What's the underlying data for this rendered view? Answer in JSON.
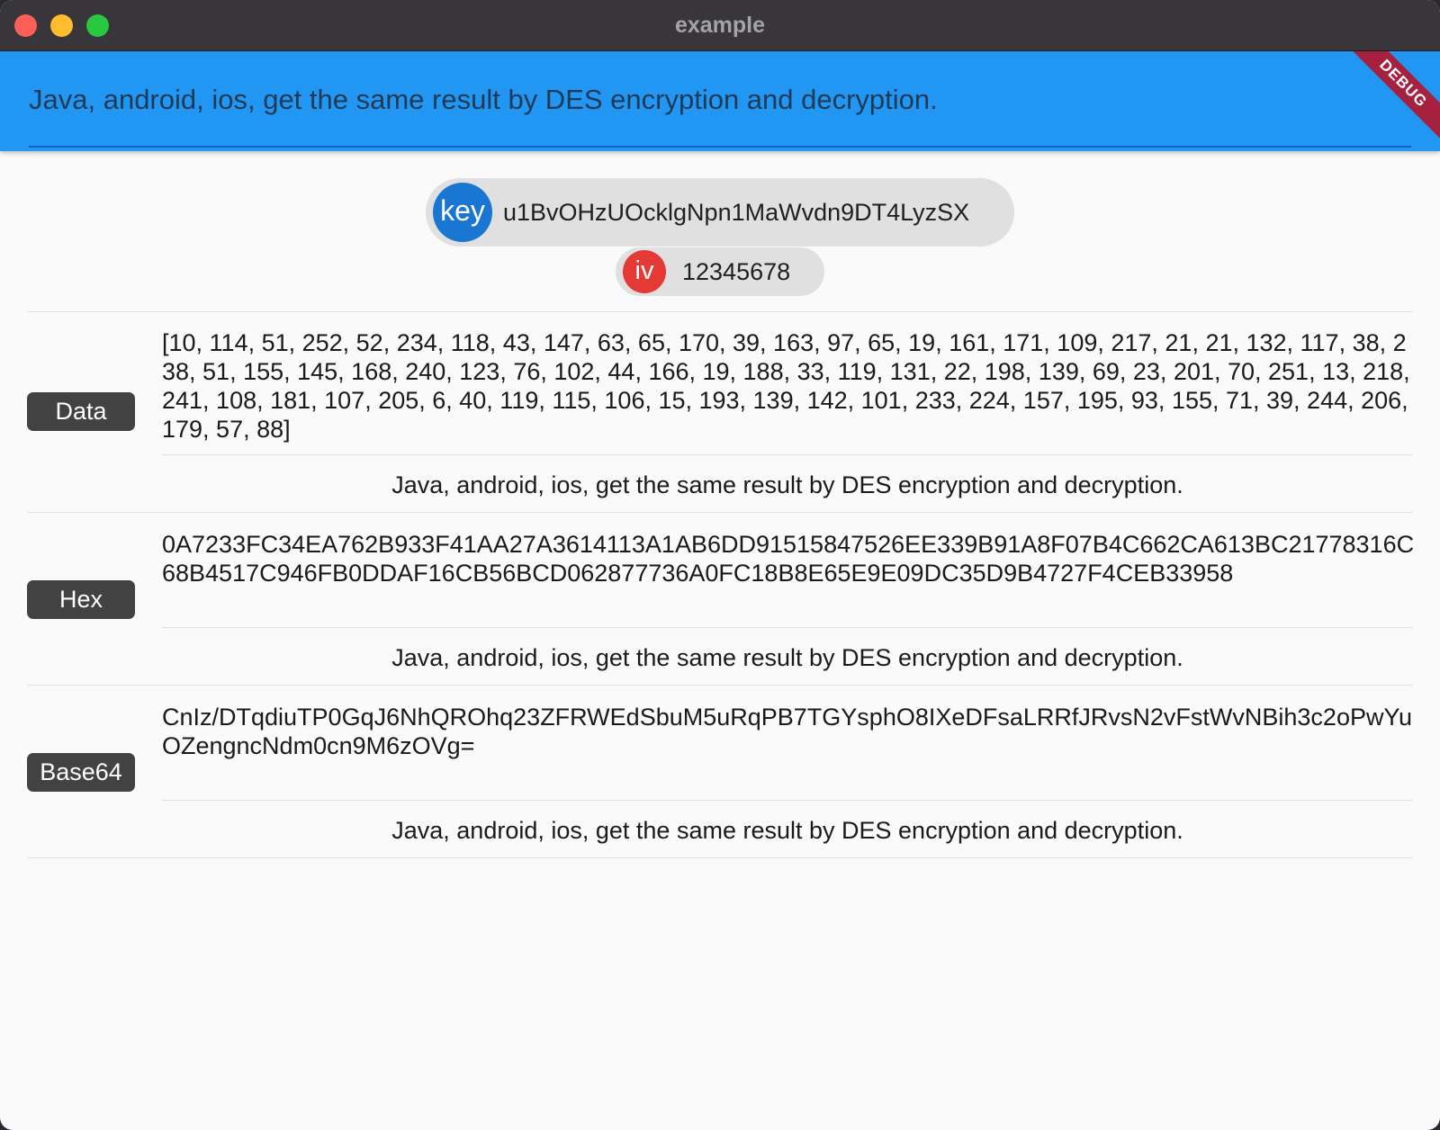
{
  "window": {
    "title": "example"
  },
  "appbar": {
    "input_value": "Java, android, ios, get the same result by DES encryption and decryption.",
    "debug_banner": "DEBUG"
  },
  "params": {
    "key": {
      "avatar": "key",
      "value": "u1BvOHzUOcklgNpn1MaWvdn9DT4LyzSX"
    },
    "iv": {
      "avatar": "iv",
      "value": "12345678"
    }
  },
  "sections": [
    {
      "label": "Data",
      "encoded": "[10, 114, 51, 252, 52, 234, 118, 43, 147, 63, 65, 170, 39, 163, 97, 65, 19, 161, 171, 109, 217, 21, 21, 132, 117, 38, 238, 51, 155, 145, 168, 240, 123, 76, 102, 44, 166, 19, 188, 33, 119, 131, 22, 198, 139, 69, 23, 201, 70, 251, 13, 218, 241, 108, 181, 107, 205, 6, 40, 119, 115, 106, 15, 193, 139, 142, 101, 233, 224, 157, 195, 93, 155, 71, 39, 244, 206, 179, 57, 88]",
      "decoded": "Java, android, ios, get the same result by DES encryption and decryption."
    },
    {
      "label": "Hex",
      "encoded": "0A7233FC34EA762B933F41AA27A3614113A1AB6DD91515847526EE339B91A8F07B4C662CA613BC21778316C68B4517C946FB0DDAF16CB56BCD062877736A0FC18B8E65E9E09DC35D9B4727F4CEB33958",
      "decoded": "Java, android, ios, get the same result by DES encryption and decryption."
    },
    {
      "label": "Base64",
      "encoded": "CnIz/DTqdiuTP0GqJ6NhQROhq23ZFRWEdSbuM5uRqPB7TGYsphO8IXeDFsaLRRfJRvsN2vFstWvNBih3c2oPwYuOZengncNdm0cn9M6zOVg=",
      "decoded": "Java, android, ios, get the same result by DES encryption and decryption."
    }
  ]
}
